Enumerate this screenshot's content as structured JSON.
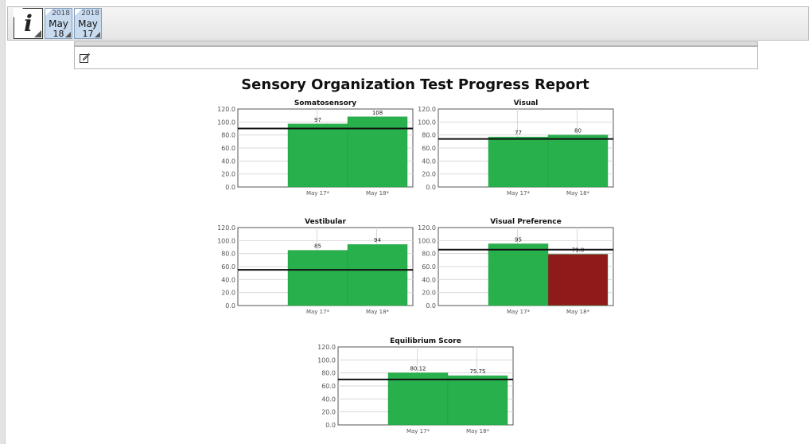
{
  "toolbar": {
    "info_icon": "info-icon",
    "sessions": [
      {
        "year": "2018",
        "month": "May",
        "day": "18"
      },
      {
        "year": "2018",
        "month": "May",
        "day": "17"
      }
    ]
  },
  "notes": {
    "icon": "edit-note-icon"
  },
  "report": {
    "title": "Sensory Organization Test Progress Report"
  },
  "colors": {
    "pass": "#27b04b",
    "fail": "#8e1a1a",
    "reference_line": "#111111"
  },
  "chart_data": [
    {
      "type": "bar",
      "title": "Somatosensory",
      "categories": [
        "May 17*",
        "May 18*"
      ],
      "values": [
        97,
        108
      ],
      "labels": [
        "97",
        "108"
      ],
      "status": [
        "pass",
        "pass"
      ],
      "reference": 90,
      "ylim": [
        0,
        120
      ],
      "yticks": [
        "0.0",
        "20.0",
        "40.0",
        "60.0",
        "80.0",
        "100.0",
        "120.0"
      ],
      "grid": true
    },
    {
      "type": "bar",
      "title": "Visual",
      "categories": [
        "May 17*",
        "May 18*"
      ],
      "values": [
        77,
        80
      ],
      "labels": [
        "77",
        "80"
      ],
      "status": [
        "pass",
        "pass"
      ],
      "reference": 74,
      "ylim": [
        0,
        120
      ],
      "yticks": [
        "0.0",
        "20.0",
        "40.0",
        "60.0",
        "80.0",
        "100.0",
        "120.0"
      ],
      "grid": true
    },
    {
      "type": "bar",
      "title": "Vestibular",
      "categories": [
        "May 17*",
        "May 18*"
      ],
      "values": [
        85,
        94
      ],
      "labels": [
        "85",
        "94"
      ],
      "status": [
        "pass",
        "pass"
      ],
      "reference": 55,
      "ylim": [
        0,
        120
      ],
      "yticks": [
        "0.0",
        "20.0",
        "40.0",
        "60.0",
        "80.0",
        "100.0",
        "120.0"
      ],
      "grid": true
    },
    {
      "type": "bar",
      "title": "Visual Preference",
      "categories": [
        "May 17*",
        "May 18*"
      ],
      "values": [
        95,
        79
      ],
      "labels": [
        "95",
        "79.0"
      ],
      "status": [
        "pass",
        "fail"
      ],
      "reference": 86,
      "ylim": [
        0,
        120
      ],
      "yticks": [
        "0.0",
        "20.0",
        "40.0",
        "60.0",
        "80.0",
        "100.0",
        "120.0"
      ],
      "grid": true
    },
    {
      "type": "bar",
      "title": "Equilibrium Score",
      "categories": [
        "May 17*",
        "May 18*"
      ],
      "values": [
        80.12,
        75.75
      ],
      "labels": [
        "80.12",
        "75.75"
      ],
      "status": [
        "pass",
        "pass"
      ],
      "reference": 70,
      "ylim": [
        0,
        120
      ],
      "yticks": [
        "0.0",
        "20.0",
        "40.0",
        "60.0",
        "80.0",
        "100.0",
        "120.0"
      ],
      "grid": true
    }
  ]
}
